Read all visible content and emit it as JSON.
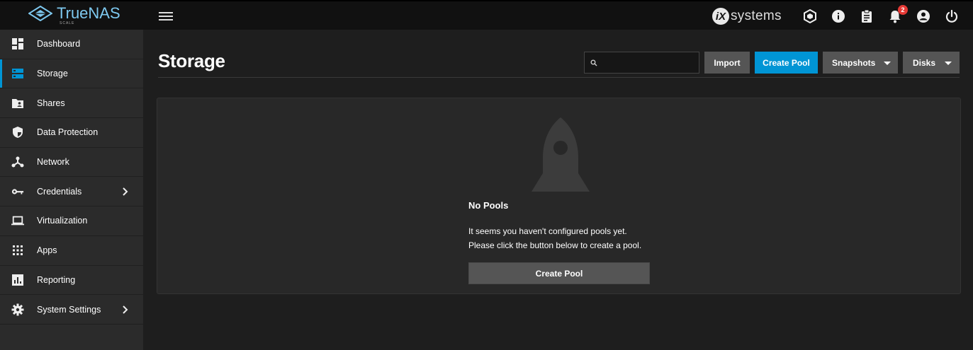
{
  "topbar": {
    "logo_text": "TrueNAS",
    "logo_sub": "SCALE",
    "vendor_mark": "iX",
    "vendor_text": "systems",
    "notification_count": "2",
    "icons": [
      "truecommand-icon",
      "info-icon",
      "clipboard-icon",
      "bell-icon",
      "account-icon",
      "power-icon"
    ]
  },
  "sidebar": {
    "items": [
      {
        "label": "Dashboard",
        "icon": "dashboard-icon",
        "active": false
      },
      {
        "label": "Storage",
        "icon": "storage-icon",
        "active": true
      },
      {
        "label": "Shares",
        "icon": "folder-shared-icon",
        "active": false
      },
      {
        "label": "Data Protection",
        "icon": "shield-icon",
        "active": false
      },
      {
        "label": "Network",
        "icon": "network-icon",
        "active": false
      },
      {
        "label": "Credentials",
        "icon": "key-icon",
        "active": false,
        "has_children": true
      },
      {
        "label": "Virtualization",
        "icon": "laptop-icon",
        "active": false
      },
      {
        "label": "Apps",
        "icon": "apps-grid-icon",
        "active": false
      },
      {
        "label": "Reporting",
        "icon": "chart-icon",
        "active": false
      },
      {
        "label": "System Settings",
        "icon": "gear-icon",
        "active": false,
        "has_children": true
      }
    ]
  },
  "main": {
    "title": "Storage",
    "search_placeholder": "",
    "buttons": {
      "import": "Import",
      "create_pool": "Create Pool",
      "snapshots": "Snapshots",
      "disks": "Disks"
    },
    "empty": {
      "title": "No Pools",
      "line1": "It seems you haven't configured pools yet.",
      "line2": "Please click the button below to create a pool.",
      "button": "Create Pool"
    }
  },
  "colors": {
    "accent": "#0095d5",
    "sidebar_bg": "#2b2b2b",
    "topbar_bg": "#111111",
    "page_bg": "#1e1e1e",
    "badge": "#e53935"
  }
}
